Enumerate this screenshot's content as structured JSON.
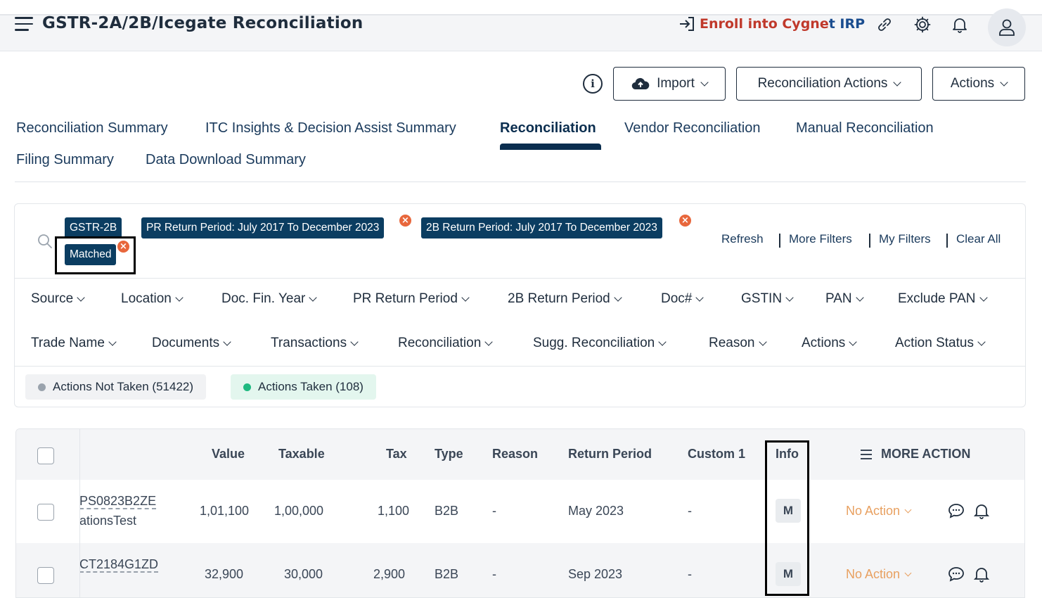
{
  "header": {
    "title": "GSTR-2A/2B/Icegate Reconciliation",
    "enroll_main": "Enroll into Cygne",
    "enroll_t": "t",
    "enroll_irp": " IRP"
  },
  "toolbar": {
    "import_label": "Import",
    "reco_actions_label": "Reconciliation Actions",
    "actions_label": "Actions"
  },
  "tabs": [
    {
      "label": "Reconciliation Summary"
    },
    {
      "label": "ITC Insights & Decision Assist Summary"
    },
    {
      "label": "Reconciliation"
    },
    {
      "label": "Vendor Reconciliation"
    },
    {
      "label": "Manual Reconciliation"
    },
    {
      "label": "Filing Summary"
    },
    {
      "label": "Data Download Summary"
    }
  ],
  "active_tab": "Reconciliation",
  "filter_chips": [
    {
      "label": "GSTR-2B"
    },
    {
      "label": "PR Return Period: July 2017 To December 2023"
    },
    {
      "label": "2B Return Period: July 2017 To December 2023"
    },
    {
      "label": "Matched"
    }
  ],
  "filter_links": {
    "refresh": "Refresh",
    "more_filters": "More Filters",
    "my_filters": "My Filters",
    "clear_all": "Clear All"
  },
  "dropdowns_row1": [
    "Source",
    "Location",
    "Doc. Fin. Year",
    "PR Return Period",
    "2B Return Period",
    "Doc#",
    "GSTIN",
    "PAN",
    "Exclude PAN"
  ],
  "dropdowns_row2": [
    "Trade Name",
    "Documents",
    "Transactions",
    "Reconciliation",
    "Sugg. Reconciliation",
    "Reason",
    "Actions",
    "Action Status"
  ],
  "status_pills": {
    "not_taken": "Actions Not Taken (51422)",
    "taken": "Actions Taken (108)"
  },
  "table": {
    "columns": [
      "Value",
      "Taxable",
      "Tax",
      "Type",
      "Reason",
      "Return Period",
      "Custom 1",
      "Info"
    ],
    "more_action": "MORE ACTION",
    "rows": [
      {
        "doc_line1": "PS0823B2ZE",
        "doc_line2": "ationsTest",
        "value": "1,01,100",
        "taxable": "1,00,000",
        "tax": "1,100",
        "type": "B2B",
        "reason": "-",
        "return_period": "May 2023",
        "custom1": "-",
        "info": "M",
        "action": "No Action"
      },
      {
        "doc_line1": "CT2184G1ZD",
        "doc_line2": "",
        "value": "32,900",
        "taxable": "30,000",
        "tax": "2,900",
        "type": "B2B",
        "reason": "-",
        "return_period": "Sep 2023",
        "custom1": "-",
        "info": "M",
        "action": "No Action"
      }
    ]
  },
  "colors": {
    "primary": "#0b3d61",
    "chip_close": "#e8673c",
    "no_action": "#e8a060",
    "taken_dot": "#1fb980",
    "not_taken_dot": "#9aa3ad"
  }
}
